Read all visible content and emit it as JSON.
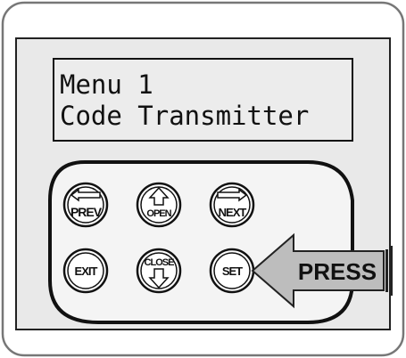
{
  "display": {
    "line1": "Menu 1",
    "line2": "Code Transmitter"
  },
  "buttons": {
    "prev": "PREV",
    "open": "OPEN",
    "next": "NEXT",
    "exit": "EXIT",
    "close": "CLOSE",
    "set": "SET"
  },
  "callout": {
    "label": "PRESS"
  }
}
